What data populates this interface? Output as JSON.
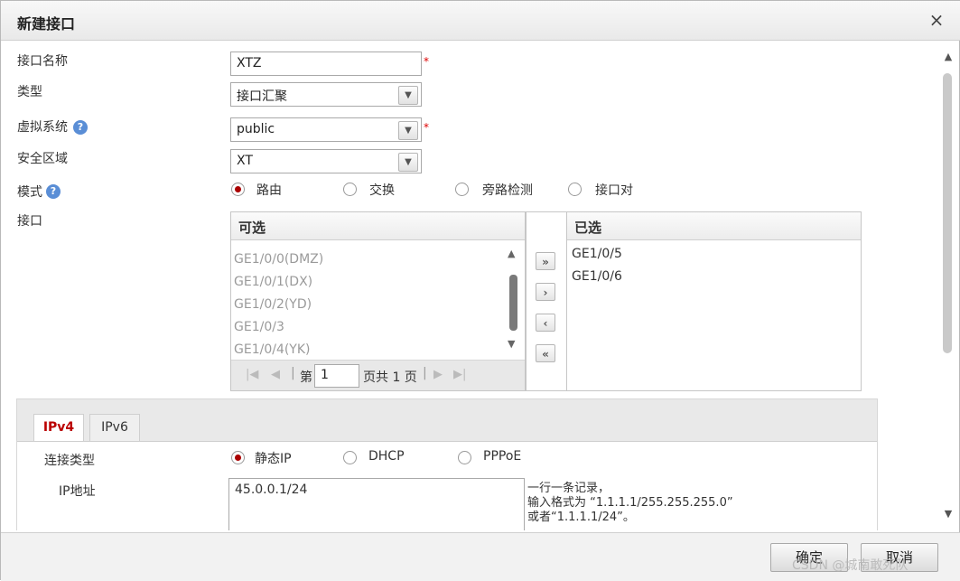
{
  "dialog": {
    "title": "新建接口",
    "close_glyph": "×"
  },
  "form": {
    "name_label": "接口名称",
    "name_value": "XTZ",
    "type_label": "类型",
    "type_value": "接口汇聚",
    "vsys_label": "虚拟系统",
    "vsys_value": "public",
    "zone_label": "安全区域",
    "zone_value": "XT",
    "mode_label": "模式",
    "mode_options": [
      "路由",
      "交换",
      "旁路检测",
      "接口对"
    ],
    "mode_selected": "路由",
    "required_mark": "*",
    "help_glyph": "?",
    "interface_label": "接口"
  },
  "interface_picker": {
    "available_header": "可选",
    "selected_header": "已选",
    "available_items": [
      "GE1/0/0(DMZ)",
      "GE1/0/1(DX)",
      "GE1/0/2(YD)",
      "GE1/0/3",
      "GE1/0/4(YK)"
    ],
    "selected_items": [
      "GE1/0/5",
      "GE1/0/6"
    ],
    "pager_prefix": "第",
    "pager_page": "1",
    "pager_suffix": "页共 1 页",
    "move_all_right": "»",
    "move_right": "›",
    "move_left": "‹",
    "move_all_left": "«"
  },
  "ip_tabs": {
    "tabs": [
      "IPv4",
      "IPv6"
    ],
    "active": "IPv4",
    "conn_type_label": "连接类型",
    "conn_options": [
      "静态IP",
      "DHCP",
      "PPPoE"
    ],
    "conn_selected": "静态IP",
    "ip_label": "IP地址",
    "ip_value": "45.0.0.1/24",
    "hint_line1": "一行一条记录，",
    "hint_line2": "输入格式为 “1.1.1.1/255.255.255.0”",
    "hint_line3": "或者“1.1.1.1/24”。"
  },
  "footer": {
    "ok_label": "确定",
    "cancel_label": "取消",
    "watermark": "CSDN @城南敢死队"
  },
  "colors": {
    "required": "#dd0000",
    "radio_on": "#aa0000",
    "active_tab": "#bb0000",
    "help_icon": "#5a8ed6"
  }
}
